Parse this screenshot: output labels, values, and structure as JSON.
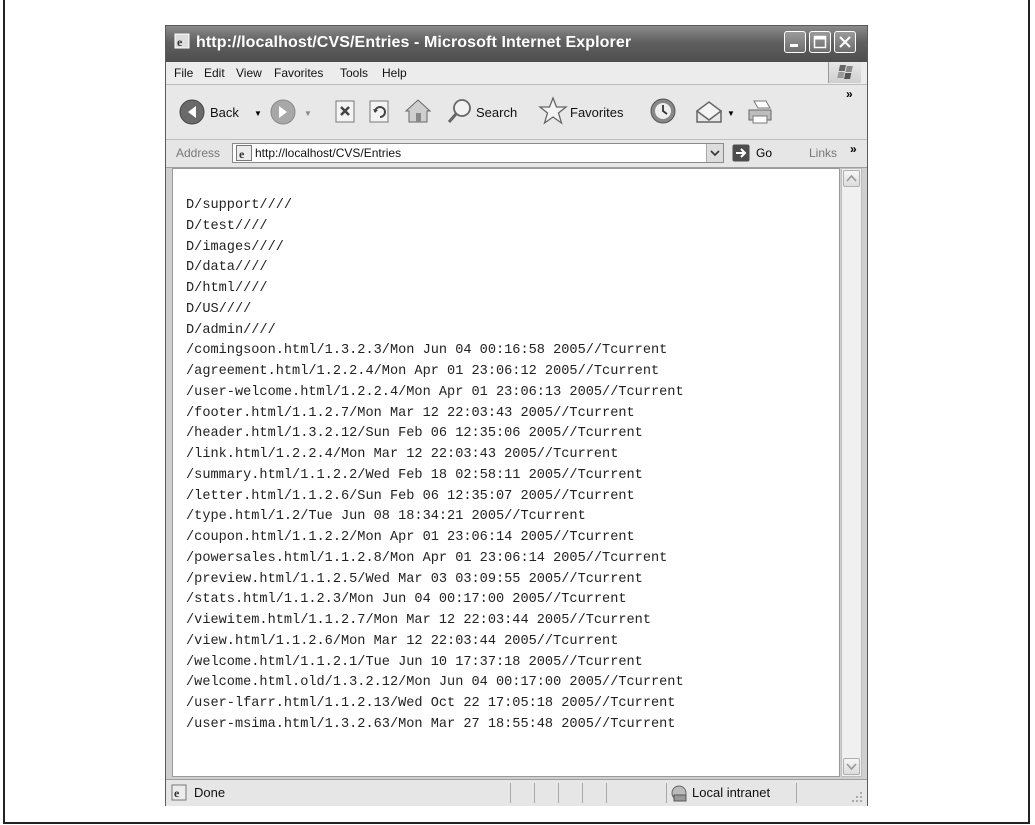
{
  "window": {
    "title": "http://localhost/CVS/Entries - Microsoft Internet Explorer"
  },
  "menu": {
    "items": [
      "File",
      "Edit",
      "View",
      "Favorites",
      "Tools",
      "Help"
    ]
  },
  "toolbar": {
    "back_label": "Back",
    "search_label": "Search",
    "favorites_label": "Favorites"
  },
  "address": {
    "label": "Address",
    "url": "http://localhost/CVS/Entries",
    "go_label": "Go",
    "links_label": "Links"
  },
  "content": {
    "lines": [
      "D/support////",
      "D/test////",
      "D/images////",
      "D/data////",
      "D/html////",
      "D/US////",
      "D/admin////",
      "/comingsoon.html/1.3.2.3/Mon Jun 04 00:16:58 2005//Tcurrent",
      "/agreement.html/1.2.2.4/Mon Apr 01 23:06:12 2005//Tcurrent",
      "/user-welcome.html/1.2.2.4/Mon Apr 01 23:06:13 2005//Tcurrent",
      "/footer.html/1.1.2.7/Mon Mar 12 22:03:43 2005//Tcurrent",
      "/header.html/1.3.2.12/Sun Feb 06 12:35:06 2005//Tcurrent",
      "/link.html/1.2.2.4/Mon Mar 12 22:03:43 2005//Tcurrent",
      "/summary.html/1.1.2.2/Wed Feb 18 02:58:11 2005//Tcurrent",
      "/letter.html/1.1.2.6/Sun Feb 06 12:35:07 2005//Tcurrent",
      "/type.html/1.2/Tue Jun 08 18:34:21 2005//Tcurrent",
      "/coupon.html/1.1.2.2/Mon Apr 01 23:06:14 2005//Tcurrent",
      "/powersales.html/1.1.2.8/Mon Apr 01 23:06:14 2005//Tcurrent",
      "/preview.html/1.1.2.5/Wed Mar 03 03:09:55 2005//Tcurrent",
      "/stats.html/1.1.2.3/Mon Jun 04 00:17:00 2005//Tcurrent",
      "/viewitem.html/1.1.2.7/Mon Mar 12 22:03:44 2005//Tcurrent",
      "/view.html/1.1.2.6/Mon Mar 12 22:03:44 2005//Tcurrent",
      "/welcome.html/1.1.2.1/Tue Jun 10 17:37:18 2005//Tcurrent",
      "/welcome.html.old/1.3.2.12/Mon Jun 04 00:17:00 2005//Tcurrent",
      "/user-lfarr.html/1.1.2.13/Wed Oct 22 17:05:18 2005//Tcurrent",
      "/user-msima.html/1.3.2.63/Mon Mar 27 18:55:48 2005//Tcurrent"
    ]
  },
  "status": {
    "text": "Done",
    "zone": "Local intranet"
  },
  "icons": [
    "ie-page-icon",
    "minimize-icon",
    "maximize-icon",
    "close-icon",
    "windows-flag-icon",
    "back-arrow-icon",
    "forward-arrow-icon",
    "stop-icon",
    "refresh-icon",
    "home-icon",
    "search-icon",
    "favorites-star-icon",
    "history-icon",
    "mail-icon",
    "print-icon",
    "go-arrow-icon",
    "intranet-icon"
  ]
}
